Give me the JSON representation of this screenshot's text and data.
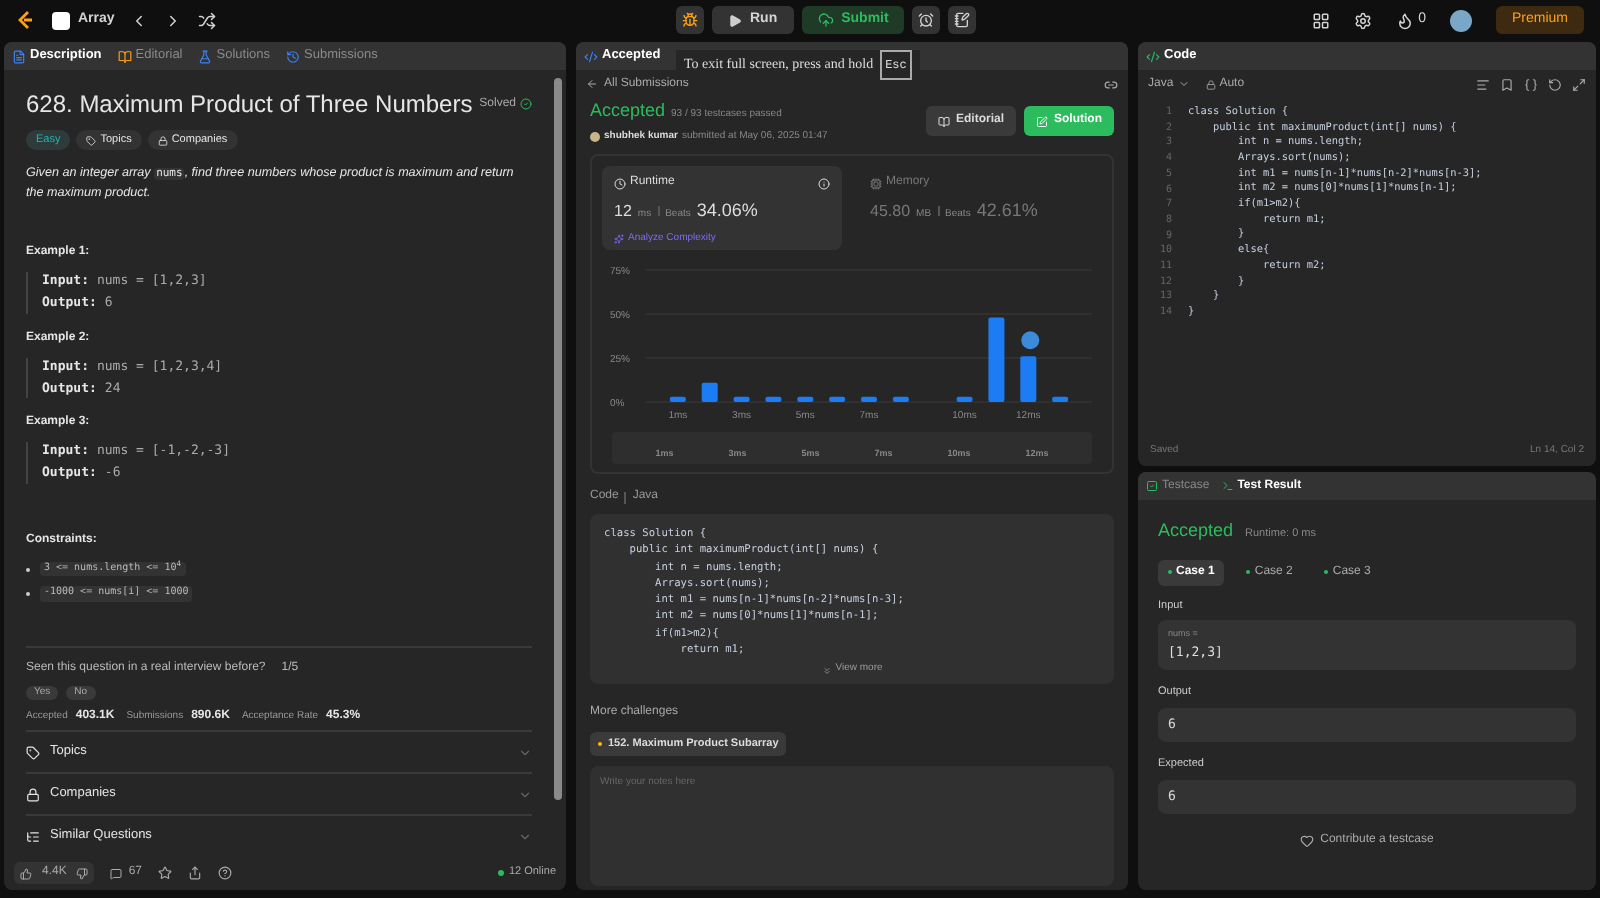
{
  "top_bar": {
    "problem_list": "Array",
    "run": "Run",
    "submit": "Submit",
    "streak": "0",
    "premium": "Premium"
  },
  "fullscreen_hint": {
    "text": "To exit full screen, press and hold",
    "key": "Esc"
  },
  "left_panel": {
    "tabs": [
      {
        "label": "Description",
        "selected": true
      },
      {
        "label": "Editorial",
        "selected": false
      },
      {
        "label": "Solutions",
        "selected": false
      },
      {
        "label": "Submissions",
        "selected": false
      }
    ],
    "title": "628. Maximum Product of Three Numbers",
    "status": "Solved",
    "difficulty": "Easy",
    "tags": [
      {
        "kind": "topics",
        "label": "Topics"
      },
      {
        "kind": "companies",
        "label": "Companies"
      }
    ],
    "description": {
      "before": "Given an integer array ",
      "code": "nums",
      "after": ", find three numbers whose product is maximum and return the maximum product."
    },
    "examples": [
      {
        "title": "Example 1:",
        "input_label": "Input:",
        "input": "nums = [1,2,3]",
        "output_label": "Output:",
        "output": "6"
      },
      {
        "title": "Example 2:",
        "input_label": "Input:",
        "input": "nums = [1,2,3,4]",
        "output_label": "Output:",
        "output": "24"
      },
      {
        "title": "Example 3:",
        "input_label": "Input:",
        "input": "nums = [-1,-2,-3]",
        "output_label": "Output:",
        "output": "-6"
      }
    ],
    "constraints_title": "Constraints:",
    "constraints": [
      "3 <= nums.length <= 10$^{4}$",
      "-1000 <= nums[i] <= 1000"
    ],
    "interview": {
      "question": "Seen this question in a real interview before?",
      "rating": "1/5",
      "answers": [
        "Yes",
        "No"
      ]
    },
    "stats": [
      {
        "label": "Accepted",
        "value": "403.1K"
      },
      {
        "label": "Submissions",
        "value": "890.6K"
      },
      {
        "label": "Acceptance Rate",
        "value": "45.3%"
      }
    ],
    "sections": [
      {
        "kind": "topics",
        "label": "Topics"
      },
      {
        "kind": "companies",
        "label": "Companies"
      },
      {
        "kind": "similar",
        "label": "Similar Questions"
      }
    ],
    "footer": {
      "likes": "4.4K",
      "comments": "67",
      "online": "12 Online"
    }
  },
  "submission_panel": {
    "tab": "Accepted",
    "back": "All Submissions",
    "status": "Accepted",
    "testcases": "93 / 93 testcases passed",
    "user": "shubhek kumar",
    "submitted": "submitted at May 06, 2025 01:47",
    "buttons": [
      {
        "kind": "editorial",
        "label": "Editorial"
      },
      {
        "kind": "solution",
        "label": "Solution"
      }
    ],
    "metrics": [
      {
        "kind": "runtime",
        "label": "Runtime",
        "value": "12",
        "unit": "ms",
        "beats_label": "Beats",
        "beats": "34.06%",
        "selected": true,
        "link": "Analyze Complexity"
      },
      {
        "kind": "memory",
        "label": "Memory",
        "value": "45.80",
        "unit": "MB",
        "beats_label": "Beats",
        "beats": "42.61%",
        "selected": false
      }
    ],
    "chart_data": {
      "type": "bar",
      "x": [
        1,
        2,
        3,
        4,
        5,
        6,
        7,
        8,
        10,
        11,
        12,
        13
      ],
      "xlim": [
        0,
        14
      ],
      "series": [
        {
          "color": "#1b7cf4",
          "values": [
            3,
            11,
            3,
            3,
            3,
            3,
            3,
            3,
            3,
            48,
            26,
            3
          ]
        }
      ],
      "ylim": [
        0,
        75
      ],
      "yticks": [
        {
          "value": 0,
          "label": "0%"
        },
        {
          "value": 25,
          "label": "25%"
        },
        {
          "value": 50,
          "label": "50%"
        },
        {
          "value": 75,
          "label": "75%"
        }
      ],
      "xticks": [
        {
          "value": 1,
          "label": "1ms"
        },
        {
          "value": 3,
          "label": "3ms"
        },
        {
          "value": 5,
          "label": "5ms"
        },
        {
          "value": 7,
          "label": "7ms"
        },
        {
          "value": 10,
          "label": "10ms"
        },
        {
          "value": 12,
          "label": "12ms"
        }
      ]
    },
    "navigator_labels": [
      "1ms",
      "3ms",
      "5ms",
      "7ms",
      "10ms",
      "12ms"
    ],
    "code_label": "Code",
    "language": "Java",
    "code": [
      "class Solution {",
      "    public int maximumProduct(int[] nums) {",
      "        int n = nums.length;",
      "        Arrays.sort(nums);",
      "        int m1 = nums[n-1]*nums[n-2]*nums[n-3];",
      "        int m2 = nums[0]*nums[1]*nums[n-1];",
      "        if(m1>m2){",
      "            return m1;"
    ],
    "view_more": "View more",
    "more_title": "More challenges",
    "challenge": "152. Maximum Product Subarray",
    "notes_placeholder": "Write your notes here"
  },
  "editor": {
    "title": "Code",
    "language": "Java",
    "mode": "Auto",
    "saved": "Saved",
    "cursor": "Ln 14, Col 2",
    "lines": [
      {
        "n": "1",
        "text": "class Solution {"
      },
      {
        "n": "2",
        "text": "    public int maximumProduct(int[] nums) {"
      },
      {
        "n": "3",
        "text": "        int n = nums.length;"
      },
      {
        "n": "4",
        "text": "        Arrays.sort(nums);"
      },
      {
        "n": "5",
        "text": "        int m1 = nums[n-1]*nums[n-2]*nums[n-3];"
      },
      {
        "n": "6",
        "text": "        int m2 = nums[0]*nums[1]*nums[n-1];"
      },
      {
        "n": "7",
        "text": "        if(m1>m2){"
      },
      {
        "n": "8",
        "text": "            return m1;"
      },
      {
        "n": "9",
        "text": "        }"
      },
      {
        "n": "10",
        "text": "        else{"
      },
      {
        "n": "11",
        "text": "            return m2;"
      },
      {
        "n": "12",
        "text": "        }"
      },
      {
        "n": "13",
        "text": "    }"
      },
      {
        "n": "14",
        "text": "}"
      }
    ]
  },
  "test_panel": {
    "tabs": [
      {
        "label": "Testcase",
        "selected": false
      },
      {
        "label": "Test Result",
        "selected": true
      }
    ],
    "status": "Accepted",
    "runtime": "Runtime: 0 ms",
    "cases": [
      {
        "label": "Case 1",
        "selected": true
      },
      {
        "label": "Case 2",
        "selected": false
      },
      {
        "label": "Case 3",
        "selected": false
      }
    ],
    "input_label": "Input",
    "param": "nums =",
    "input": "[1,2,3]",
    "output_label": "Output",
    "output": "6",
    "expected_label": "Expected",
    "expected": "6",
    "contribute": "Contribute a testcase"
  }
}
